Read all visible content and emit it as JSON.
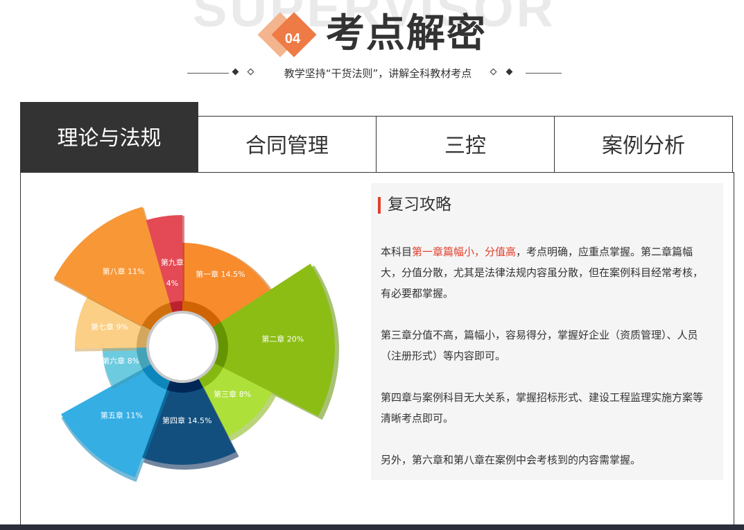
{
  "header": {
    "ghost_word": "SUPERVISOR",
    "badge_number": "04",
    "title": "考点解密",
    "subtitle": "教学坚持“干货法则”，讲解全科教材考点"
  },
  "tabs": [
    {
      "label": "理论与法规",
      "active": true
    },
    {
      "label": "合同管理",
      "active": false
    },
    {
      "label": "三控",
      "active": false
    },
    {
      "label": "案例分析",
      "active": false
    }
  ],
  "chart_data": {
    "type": "pie",
    "categories": [
      "第一章",
      "第二章",
      "第三章",
      "第四章",
      "第五章",
      "第六章",
      "第七章",
      "第八章",
      "第九章"
    ],
    "values": [
      14.5,
      20,
      8,
      14.5,
      11,
      8,
      9,
      11,
      4
    ],
    "labels": [
      "14.5%",
      "20%",
      "8%",
      "14.5%",
      "11%",
      "8%",
      "9%",
      "11%",
      "4%"
    ],
    "colors": [
      "#f88b2c",
      "#8cbd14",
      "#aee03a",
      "#124f7e",
      "#35aee4",
      "#6dcbe0",
      "#fbcf86",
      "#f89736",
      "#e34a55"
    ],
    "title": "",
    "legend": "none"
  },
  "review": {
    "title": "复习攻略",
    "p1_pre": "本科目",
    "p1_highlight": "第一章篇幅小，分值高",
    "p1_post": "，考点明确，应重点掌握。第二章篇幅大，分值分散，尤其是法律法规内容虽分散，但在案例科目经常考核，有必要都掌握。",
    "p2": "第三章分值不高，篇幅小，容易得分，掌握好企业（资质管理）、人员（注册形式）等内容即可。",
    "p3": "第四章与案例科目无大关系，掌握招标形式、建设工程监理实施方案等清晰考点即可。",
    "p4": "另外，第六章和第八章在案例中会考核到的内容需掌握。"
  }
}
